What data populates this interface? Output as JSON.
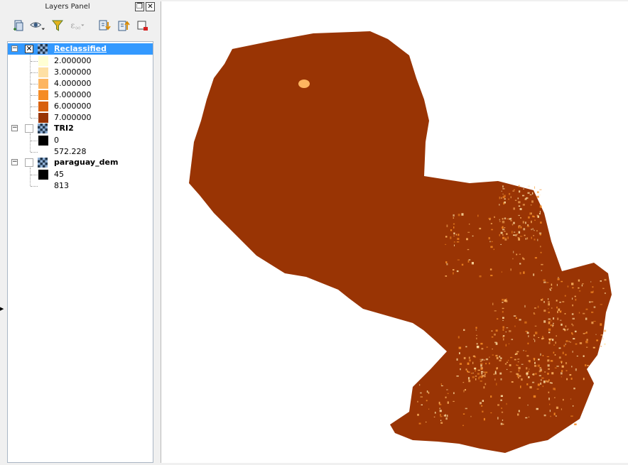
{
  "panel": {
    "title": "Layers Panel"
  },
  "layers": [
    {
      "name": "Reclassified",
      "checked": true,
      "selected": true,
      "legend": [
        {
          "label": "2.000000",
          "color": "#ffffd4"
        },
        {
          "label": "3.000000",
          "color": "#fee0a4"
        },
        {
          "label": "4.000000",
          "color": "#fdb560"
        },
        {
          "label": "5.000000",
          "color": "#f58b24"
        },
        {
          "label": "6.000000",
          "color": "#d8600e"
        },
        {
          "label": "7.000000",
          "color": "#993404"
        }
      ]
    },
    {
      "name": "TRI2",
      "checked": false,
      "selected": false,
      "legend": [
        {
          "label": "0",
          "color": "#000000"
        },
        {
          "label": "572.228",
          "color": "#ffffff"
        }
      ]
    },
    {
      "name": "paraguay_dem",
      "checked": false,
      "selected": false,
      "legend": [
        {
          "label": "45",
          "color": "#000000"
        },
        {
          "label": "813",
          "color": "#ffffff"
        }
      ]
    }
  ],
  "map": {
    "fill_color": "#993404",
    "highlight_colors": [
      "#fdb560",
      "#f58b24",
      "#fee0a4"
    ]
  }
}
